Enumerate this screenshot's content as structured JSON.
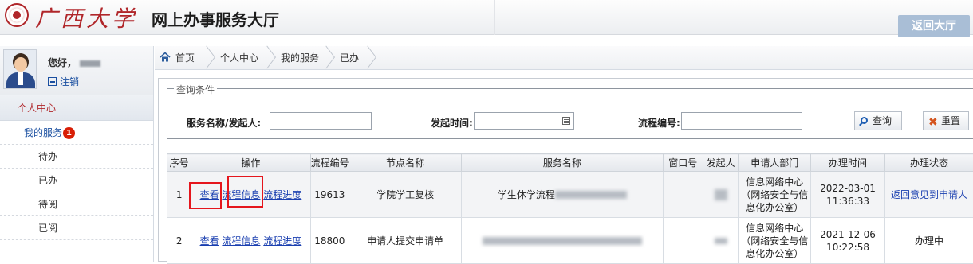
{
  "header": {
    "logo_text": "广西大学",
    "site_title": "网上办事服务大厅",
    "back_button": "返回大厅"
  },
  "sidebar": {
    "greeting": "您好，",
    "logout": "注销",
    "section": "个人中心",
    "my_services": "我的服务",
    "my_services_badge": "1",
    "items": [
      {
        "label": "待办"
      },
      {
        "label": "已办"
      },
      {
        "label": "待阅"
      },
      {
        "label": "已阅"
      }
    ]
  },
  "breadcrumb": [
    "首页",
    "个人中心",
    "我的服务",
    "已办"
  ],
  "query": {
    "legend": "查询条件",
    "service_label": "服务名称/发起人:",
    "service_value": "",
    "start_time_label": "发起时间:",
    "start_time_value": "",
    "flow_no_label": "流程编号:",
    "flow_no_value": "",
    "search_button": "查询",
    "reset_button": "重置"
  },
  "table": {
    "headers": [
      "序号",
      "操作",
      "流程编号",
      "节点名称",
      "服务名称",
      "窗口号",
      "发起人",
      "申请人部门",
      "办理时间",
      "办理状态"
    ],
    "actions": {
      "view": "查看",
      "flow_info": "流程信息",
      "flow_progress": "流程进度"
    },
    "rows": [
      {
        "index": "1",
        "flow_no": "19613",
        "node": "学院学工复核",
        "service": "学生休学流程",
        "window": "",
        "initiator": "",
        "dept": "信息网络中心（网络安全与信息化办公室）",
        "time": "2022-03-01 11:36:33",
        "status": "返回意见到申请人"
      },
      {
        "index": "2",
        "flow_no": "18800",
        "node": "申请人提交申请单",
        "service": "",
        "window": "",
        "initiator": "",
        "dept": "信息网络中心（网络安全与信息化办公室）",
        "time": "2021-12-06 10:22:58",
        "status": "办理中"
      }
    ]
  },
  "colors": {
    "brand_red": "#b0262a",
    "link_blue": "#1a3fb0",
    "highlight_red": "#e5161d",
    "back_button_bg": "#a9bed6"
  }
}
